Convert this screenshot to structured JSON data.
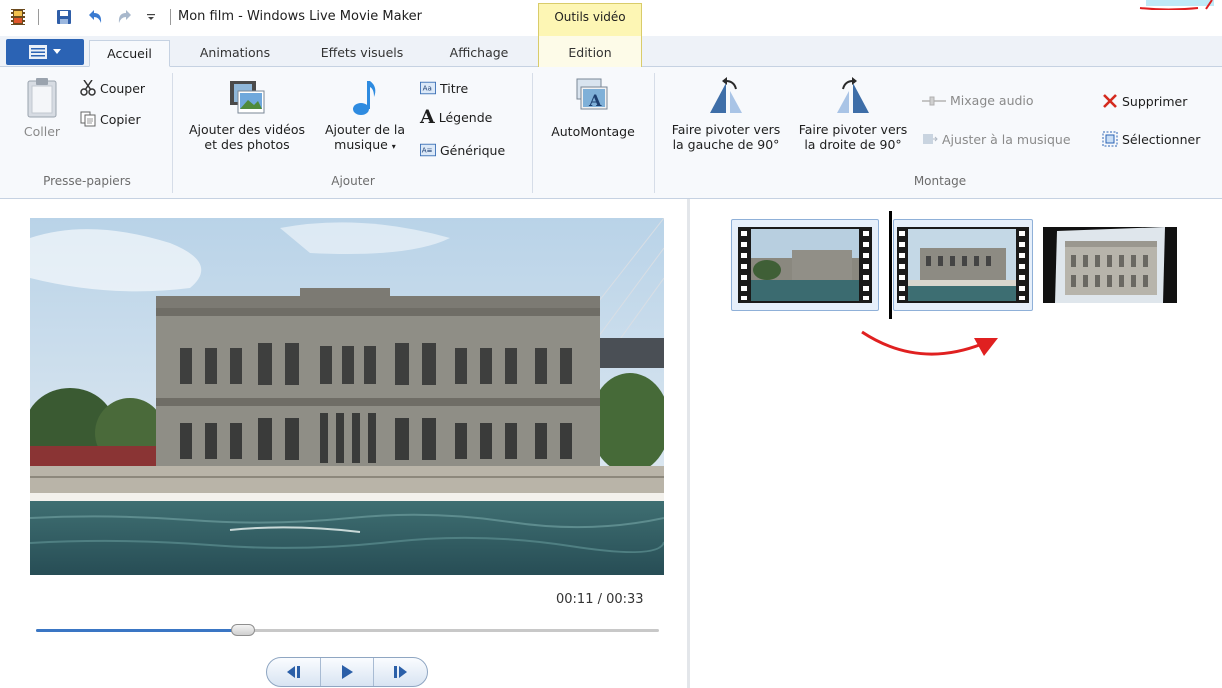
{
  "window": {
    "title": "Mon film - Windows Live Movie Maker",
    "context_tab_group": "Outils vidéo"
  },
  "tabs": [
    {
      "label": "Accueil",
      "active": true
    },
    {
      "label": "Animations",
      "active": false
    },
    {
      "label": "Effets visuels",
      "active": false
    },
    {
      "label": "Affichage",
      "active": false
    },
    {
      "label": "Edition",
      "active": false,
      "contextual": true
    }
  ],
  "ribbon": {
    "clipboard": {
      "group_label": "Presse-papiers",
      "paste": "Coller",
      "cut": "Couper",
      "copy": "Copier"
    },
    "add": {
      "group_label": "Ajouter",
      "add_videos": [
        "Ajouter des vidéos",
        "et des photos"
      ],
      "add_music": [
        "Ajouter de la",
        "musique"
      ],
      "title": "Titre",
      "caption": "Légende",
      "credits": "Générique"
    },
    "automovie": "AutoMontage",
    "editing": {
      "group_label": "Montage",
      "rotate_left": [
        "Faire pivoter vers",
        "la gauche de 90°"
      ],
      "rotate_right": [
        "Faire pivoter vers",
        "la droite de 90°"
      ],
      "audio_mix": "Mixage audio",
      "fit_to_music": "Ajuster à la musique",
      "remove": "Supprimer",
      "select": "Sélectionner"
    }
  },
  "preview": {
    "time": "00:11 / 00:33",
    "progress": 0.333
  },
  "storyboard": {
    "clips": [
      {
        "name": "clip-1",
        "selected": true
      },
      {
        "name": "clip-2",
        "selected": true
      },
      {
        "name": "clip-3",
        "selected": false
      }
    ]
  },
  "colors": {
    "accent": "#2b63b4",
    "context_tab": "#fdf6b4",
    "arrow": "#e02020"
  },
  "icons": {
    "app": "film-icon",
    "save": "save-icon",
    "undo": "undo-icon",
    "redo": "redo-icon",
    "remove": "red-x-icon"
  }
}
